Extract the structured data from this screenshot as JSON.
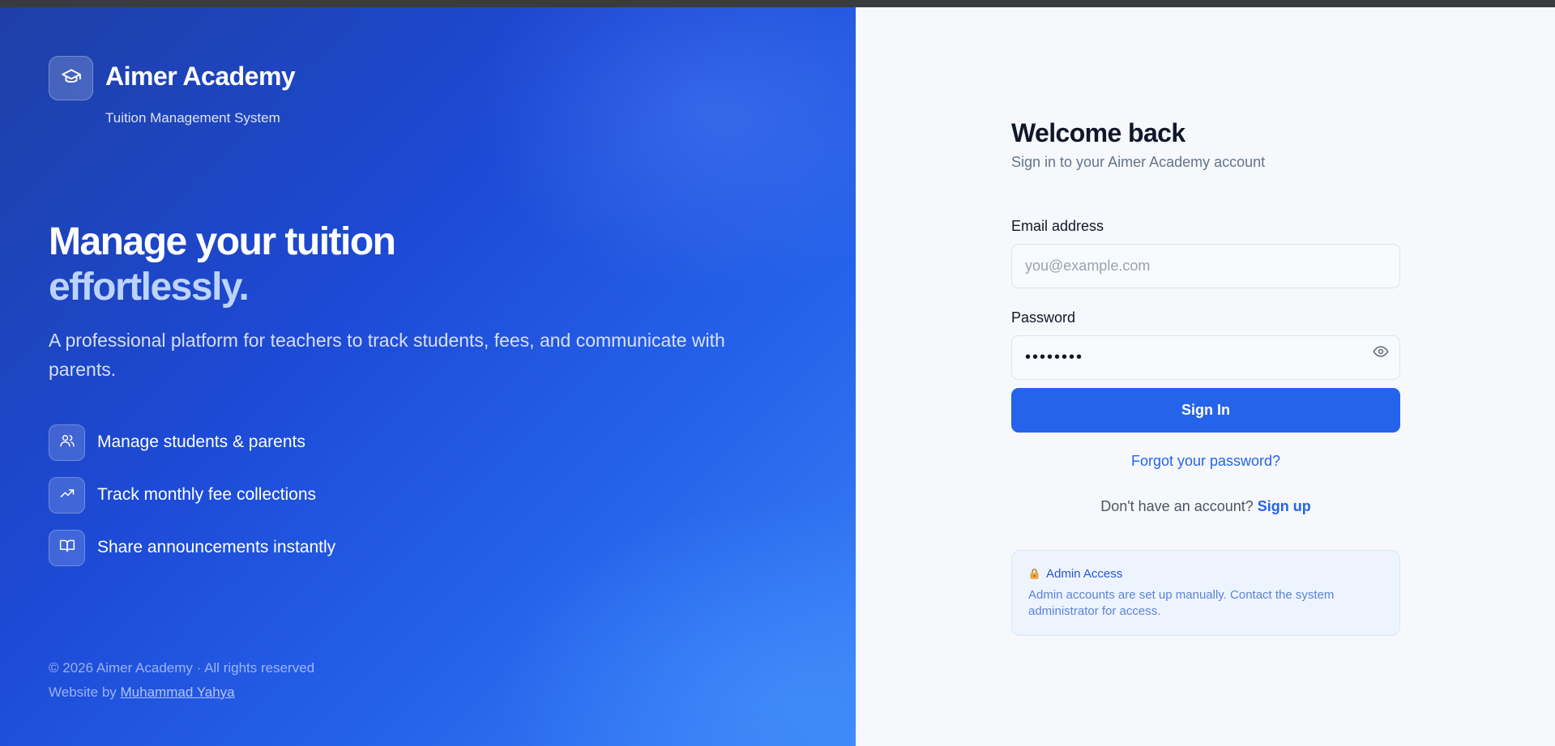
{
  "brand": {
    "name": "Aimer Academy",
    "subtitle": "Tuition Management System",
    "icon": "graduation-cap-icon"
  },
  "hero": {
    "line1": "Manage your tuition",
    "line2": "effortlessly.",
    "description": "A professional platform for teachers to track students, fees, and communicate with parents."
  },
  "features": [
    {
      "icon": "users-icon",
      "label": "Manage students & parents"
    },
    {
      "icon": "trending-up-icon",
      "label": "Track monthly fee collections"
    },
    {
      "icon": "book-open-icon",
      "label": "Share announcements instantly"
    }
  ],
  "footer": {
    "copyright": "© 2026 Aimer Academy · All rights reserved",
    "credit_prefix": "Website by",
    "credit_name": "Muhammad Yahya"
  },
  "login": {
    "title": "Welcome back",
    "subtitle": "Sign in to your Aimer Academy account",
    "email_label": "Email address",
    "email_placeholder": "you@example.com",
    "email_value": "",
    "password_label": "Password",
    "password_value": "password",
    "signin_label": "Sign In",
    "forgot_label": "Forgot your password?",
    "no_account_text": "Don't have an account?",
    "signup_label": "Sign up"
  },
  "admin": {
    "icon": "lock-icon",
    "title": "Admin Access",
    "description": "Admin accounts are set up manually. Contact the system administrator for access."
  },
  "colors": {
    "primary": "#2563eb",
    "panel_gradient_start": "#1e3fa6",
    "panel_gradient_end": "#3b82f6",
    "right_background": "#f6f8fc"
  }
}
